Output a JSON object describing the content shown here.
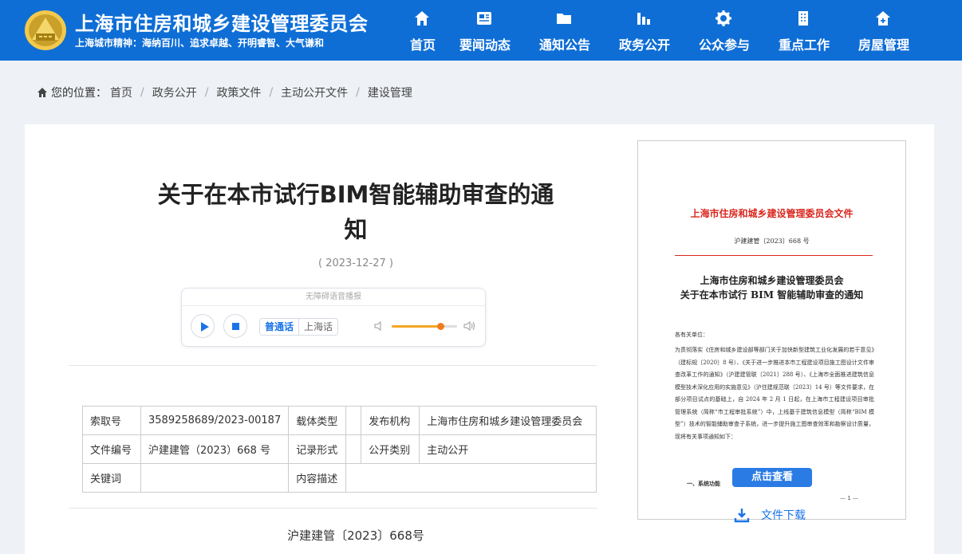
{
  "header": {
    "site_title": "上海市住房和城乡建设管理委员会",
    "site_motto": "上海城市精神：海纳百川、追求卓越、开明睿智、大气谦和",
    "nav": [
      {
        "label": "首页",
        "icon": "home-icon"
      },
      {
        "label": "要闻动态",
        "icon": "news-icon"
      },
      {
        "label": "通知公告",
        "icon": "folder-icon"
      },
      {
        "label": "政务公开",
        "icon": "chart-icon"
      },
      {
        "label": "公众参与",
        "icon": "gear-icon"
      },
      {
        "label": "重点工作",
        "icon": "building-icon"
      },
      {
        "label": "房屋管理",
        "icon": "house-icon"
      }
    ]
  },
  "breadcrumb": {
    "prefix": "您的位置：",
    "items": [
      "首页",
      "政务公开",
      "政策文件",
      "主动公开文件",
      "建设管理"
    ]
  },
  "article": {
    "title": "关于在本市试行BIM智能辅助审查的通知",
    "date": "( 2023-12-27 )",
    "doc_number": "沪建建管〔2023〕668号"
  },
  "player": {
    "title": "无障碍语音播报",
    "lang_active": "普通话",
    "lang_inactive": "上海话",
    "volume": 0.75
  },
  "meta_table": {
    "index_label": "索取号",
    "index_value": "3589258689/2023-00187",
    "carrier_label": "载体类型",
    "carrier_value": "",
    "publisher_label": "发布机构",
    "publisher_value": "上海市住房和城乡建设管理委员会",
    "docno_label": "文件编号",
    "docno_value": "沪建建管（2023）668 号",
    "record_label": "记录形式",
    "record_value": "",
    "category_label": "公开类别",
    "category_value": "主动公开",
    "keywords_label": "关键词",
    "keywords_value": "",
    "desc_label": "内容描述",
    "desc_value": ""
  },
  "preview": {
    "red_header": "上海市住房和城乡建设管理委员会文件",
    "doc_no": "沪建建管〔2023〕668 号",
    "title_line1": "上海市住房和城乡建设管理委员会",
    "title_line2": "关于在本市试行 BIM 智能辅助审查的通知",
    "salutation": "各有关单位：",
    "body": "为贯彻落实《住房和城乡建设部等部门关于加快新型建筑工业化发展的若干意见》（建标规〔2020〕8 号）、《关于进一步推进本市工程建设项目施工图设计文件审查改革工作的通知》（沪建建管联〔2021〕288 号）、《上海市全面推进建筑信息模型技术深化应用的实施意见》（沪住建规范联〔2023〕14 号）等文件要求，在部分项目试点的基础上，自 2024 年 2 月 1 日起，在上海市工程建设项目审批管理系统（简称“市工程审批系统”）中，上线基于建筑信息模型（简称“BIM 模型”）技术的智能辅助审查子系统，进一步提升施工图审查效率和勘察设计质量，现将有关事项通知如下：",
    "section_heading": "一、系统功能",
    "page_mark": "— 1 —",
    "view_button": "点击查看",
    "download_label": "文件下载"
  }
}
